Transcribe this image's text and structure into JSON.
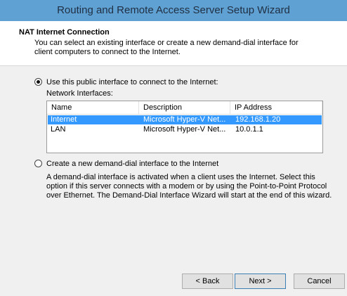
{
  "window": {
    "title": "Routing and Remote Access Server Setup Wizard"
  },
  "header": {
    "title": "NAT Internet Connection",
    "subtitle": "You can select an existing interface or create a new demand-dial interface for client computers to connect to the Internet."
  },
  "option_public": {
    "label": "Use this public interface to connect to the Internet:",
    "selected": true,
    "list_label": "Network Interfaces:"
  },
  "interfaces": {
    "columns": [
      "Name",
      "Description",
      "IP Address"
    ],
    "rows": [
      {
        "name": "Internet",
        "description": "Microsoft Hyper-V Net...",
        "ip": "192.168.1.20",
        "selected": true
      },
      {
        "name": "LAN",
        "description": "Microsoft Hyper-V Net...",
        "ip": "10.0.1.1",
        "selected": false
      }
    ]
  },
  "option_demand_dial": {
    "label": "Create a new demand-dial interface to the Internet",
    "selected": false,
    "description": "A demand-dial interface is activated when a client uses the Internet. Select this option if this server connects with a modem or by using the Point-to-Point Protocol over Ethernet. The Demand-Dial Interface Wizard will start at the end of this wizard."
  },
  "buttons": {
    "back": "< Back",
    "next": "Next >",
    "cancel": "Cancel"
  },
  "colors": {
    "titlebar": "#60a1d3",
    "selection": "#3399ff"
  }
}
